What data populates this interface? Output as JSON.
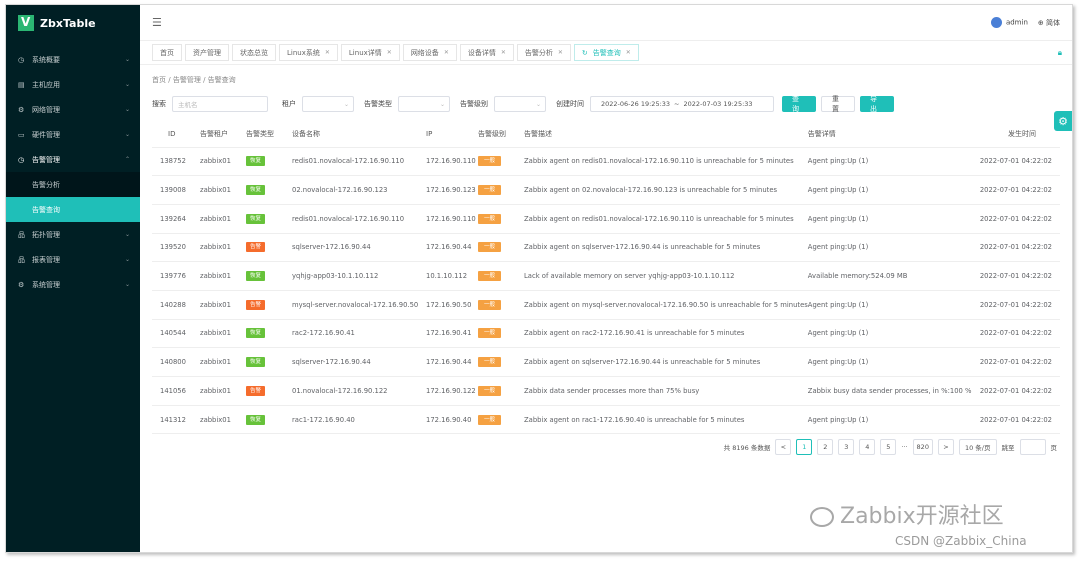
{
  "app": {
    "logo_text": "ZbxTable"
  },
  "sidebar": {
    "items": [
      {
        "label": "系统概要",
        "icon": "dashboard-icon",
        "glyph": "◷"
      },
      {
        "label": "主机应用",
        "icon": "host-icon",
        "glyph": "▤"
      },
      {
        "label": "网络管理",
        "icon": "network-icon",
        "glyph": "⚙"
      },
      {
        "label": "硬件管理",
        "icon": "folder-icon",
        "glyph": "▭"
      },
      {
        "label": "告警管理",
        "icon": "alarm-icon",
        "glyph": "◷"
      }
    ],
    "sub_items": [
      {
        "label": "告警分析"
      },
      {
        "label": "告警查询"
      }
    ],
    "items_after": [
      {
        "label": "拓扑管理",
        "icon": "topology-icon",
        "glyph": "品"
      },
      {
        "label": "报表管理",
        "icon": "report-icon",
        "glyph": "品"
      },
      {
        "label": "系统管理",
        "icon": "settings-icon",
        "glyph": "⚙"
      }
    ]
  },
  "header": {
    "user": "admin",
    "lang": "简体"
  },
  "tabs": [
    {
      "label": "首页",
      "closable": false
    },
    {
      "label": "资产管理",
      "closable": false
    },
    {
      "label": "状态总览",
      "closable": false
    },
    {
      "label": "Linux系统",
      "closable": true
    },
    {
      "label": "Linux详情",
      "closable": true
    },
    {
      "label": "网络设备",
      "closable": true
    },
    {
      "label": "设备详情",
      "closable": true
    },
    {
      "label": "告警分析",
      "closable": true
    },
    {
      "label": "告警查询",
      "closable": true,
      "active": true
    }
  ],
  "breadcrumb": {
    "home": "首页",
    "sep": "/",
    "section": "告警管理",
    "page": "告警查询"
  },
  "search": {
    "search_label": "搜索",
    "search_placeholder": "主机名",
    "tenant_label": "租户",
    "type_label": "告警类型",
    "level_label": "告警级别",
    "time_label": "创建时间",
    "date_start": "2022-06-26 19:25:33",
    "date_sep": "~",
    "date_end": "2022-07-03 19:25:33",
    "query_btn": "查 询",
    "reset_btn": "重 置",
    "export_btn": "导 出"
  },
  "table": {
    "headers": [
      "ID",
      "告警租户",
      "告警类型",
      "设备名称",
      "IP",
      "告警级别",
      "告警描述",
      "告警详情",
      "发生时间"
    ],
    "rows": [
      {
        "id": "138752",
        "tenant": "zabbix01",
        "type": "恢复",
        "type_status": "ok",
        "device": "redis01.novalocal-172.16.90.110",
        "ip": "172.16.90.110",
        "level": "一般",
        "desc": "Zabbix agent on redis01.novalocal-172.16.90.110 is unreachable for 5 minutes",
        "detail": "Agent ping:Up (1)",
        "time": "2022-07-01 04:22:02"
      },
      {
        "id": "139008",
        "tenant": "zabbix01",
        "type": "恢复",
        "type_status": "ok",
        "device": "02.novalocal-172.16.90.123",
        "ip": "172.16.90.123",
        "level": "一般",
        "desc": "Zabbix agent on 02.novalocal-172.16.90.123 is unreachable for 5 minutes",
        "detail": "Agent ping:Up (1)",
        "time": "2022-07-01 04:22:02"
      },
      {
        "id": "139264",
        "tenant": "zabbix01",
        "type": "恢复",
        "type_status": "ok",
        "device": "redis01.novalocal-172.16.90.110",
        "ip": "172.16.90.110",
        "level": "一般",
        "desc": "Zabbix agent on redis01.novalocal-172.16.90.110 is unreachable for 5 minutes",
        "detail": "Agent ping:Up (1)",
        "time": "2022-07-01 04:22:02"
      },
      {
        "id": "139520",
        "tenant": "zabbix01",
        "type": "告警",
        "type_status": "bad",
        "device": "sqlserver-172.16.90.44",
        "ip": "172.16.90.44",
        "level": "一般",
        "desc": "Zabbix agent on sqlserver-172.16.90.44 is unreachable for 5 minutes",
        "detail": "Agent ping:Up (1)",
        "time": "2022-07-01 04:22:02"
      },
      {
        "id": "139776",
        "tenant": "zabbix01",
        "type": "恢复",
        "type_status": "ok",
        "device": "yqhjg-app03-10.1.10.112",
        "ip": "10.1.10.112",
        "level": "一般",
        "desc": "Lack of available memory on server yqhjg-app03-10.1.10.112",
        "detail": "Available memory:524.09 MB",
        "time": "2022-07-01 04:22:02"
      },
      {
        "id": "140288",
        "tenant": "zabbix01",
        "type": "告警",
        "type_status": "bad",
        "device": "mysql-server.novalocal-172.16.90.50",
        "ip": "172.16.90.50",
        "level": "一般",
        "desc": "Zabbix agent on mysql-server.novalocal-172.16.90.50 is unreachable for 5 minutes",
        "detail": "Agent ping:Up (1)",
        "time": "2022-07-01 04:22:02"
      },
      {
        "id": "140544",
        "tenant": "zabbix01",
        "type": "恢复",
        "type_status": "ok",
        "device": "rac2-172.16.90.41",
        "ip": "172.16.90.41",
        "level": "一般",
        "desc": "Zabbix agent on rac2-172.16.90.41 is unreachable for 5 minutes",
        "detail": "Agent ping:Up (1)",
        "time": "2022-07-01 04:22:02"
      },
      {
        "id": "140800",
        "tenant": "zabbix01",
        "type": "恢复",
        "type_status": "ok",
        "device": "sqlserver-172.16.90.44",
        "ip": "172.16.90.44",
        "level": "一般",
        "desc": "Zabbix agent on sqlserver-172.16.90.44 is unreachable for 5 minutes",
        "detail": "Agent ping:Up (1)",
        "time": "2022-07-01 04:22:02"
      },
      {
        "id": "141056",
        "tenant": "zabbix01",
        "type": "告警",
        "type_status": "bad",
        "device": "01.novalocal-172.16.90.122",
        "ip": "172.16.90.122",
        "level": "一般",
        "desc": "Zabbix data sender processes more than 75% busy",
        "detail": "Zabbix busy data sender processes, in %:100 %",
        "time": "2022-07-01 04:22:02"
      },
      {
        "id": "141312",
        "tenant": "zabbix01",
        "type": "恢复",
        "type_status": "ok",
        "device": "rac1-172.16.90.40",
        "ip": "172.16.90.40",
        "level": "一般",
        "desc": "Zabbix agent on rac1-172.16.90.40 is unreachable for 5 minutes",
        "detail": "Agent ping:Up (1)",
        "time": "2022-07-01 04:22:02"
      }
    ]
  },
  "pagination": {
    "total": "共 8196 条数据",
    "prev": "<",
    "pages": [
      "1",
      "2",
      "3",
      "4",
      "5"
    ],
    "ellipsis": "···",
    "last": "820",
    "next": ">",
    "page_size": "10 条/页",
    "jump_label": "跳至",
    "page_suffix": "页"
  },
  "watermark": {
    "line1": "Zabbix开源社区",
    "line2": "CSDN @Zabbix_China"
  },
  "colors": {
    "accent": "#1fbfb8",
    "sidebar_bg": "#001f24",
    "ok": "#67c23a",
    "alarm": "#f56c2c",
    "level": "#f5a142"
  }
}
